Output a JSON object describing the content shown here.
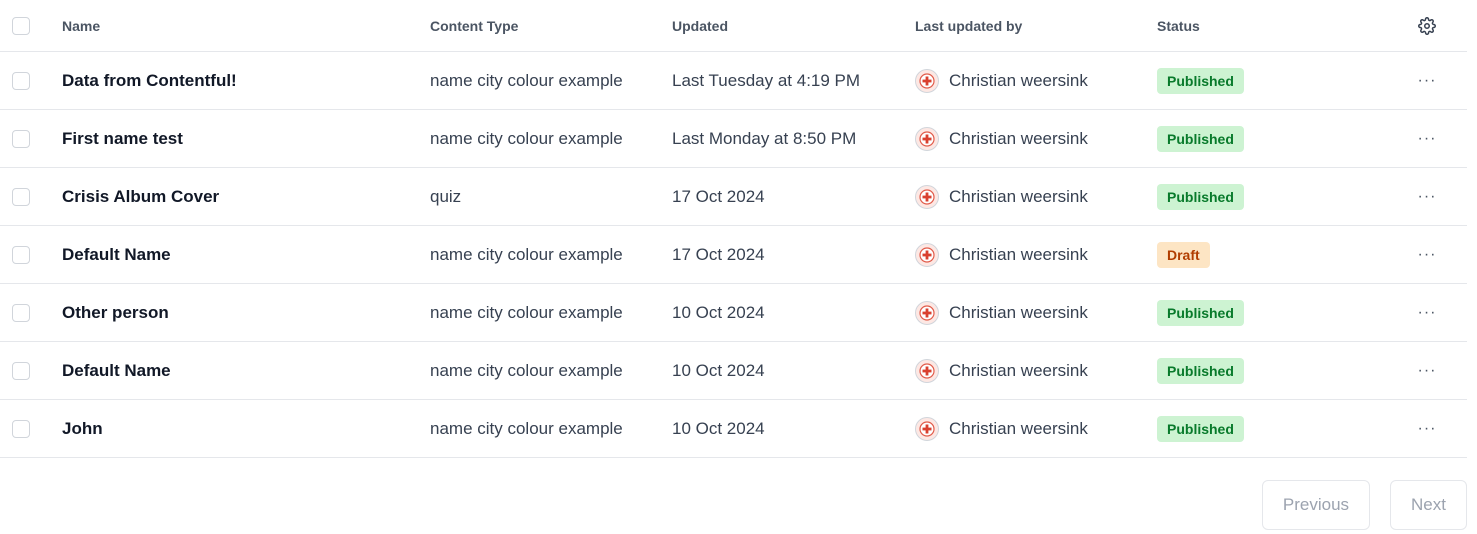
{
  "header": {
    "name": "Name",
    "content_type": "Content Type",
    "updated": "Updated",
    "last_updated_by": "Last updated by",
    "status": "Status",
    "settings_icon": "gear-icon"
  },
  "rows": [
    {
      "name": "Data from Contentful!",
      "content_type": "name city colour example",
      "updated": "Last Tuesday at 4:19 PM",
      "by": "Christian weersink",
      "status": "Published"
    },
    {
      "name": "First name test",
      "content_type": "name city colour example",
      "updated": "Last Monday at 8:50 PM",
      "by": "Christian weersink",
      "status": "Published"
    },
    {
      "name": "Crisis Album Cover",
      "content_type": "quiz",
      "updated": "17 Oct 2024",
      "by": "Christian weersink",
      "status": "Published"
    },
    {
      "name": "Default Name",
      "content_type": "name city colour example",
      "updated": "17 Oct 2024",
      "by": "Christian weersink",
      "status": "Draft"
    },
    {
      "name": "Other person",
      "content_type": "name city colour example",
      "updated": "10 Oct 2024",
      "by": "Christian weersink",
      "status": "Published"
    },
    {
      "name": "Default Name",
      "content_type": "name city colour example",
      "updated": "10 Oct 2024",
      "by": "Christian weersink",
      "status": "Published"
    },
    {
      "name": "John",
      "content_type": "name city colour example",
      "updated": "10 Oct 2024",
      "by": "Christian weersink",
      "status": "Published"
    }
  ],
  "row_action_label": "···",
  "pagination": {
    "previous": "Previous",
    "next": "Next"
  },
  "colors": {
    "published_bg": "#cdf3d2",
    "published_text": "#087a2b",
    "draft_bg": "#fde5c4",
    "draft_text": "#b13d00"
  }
}
